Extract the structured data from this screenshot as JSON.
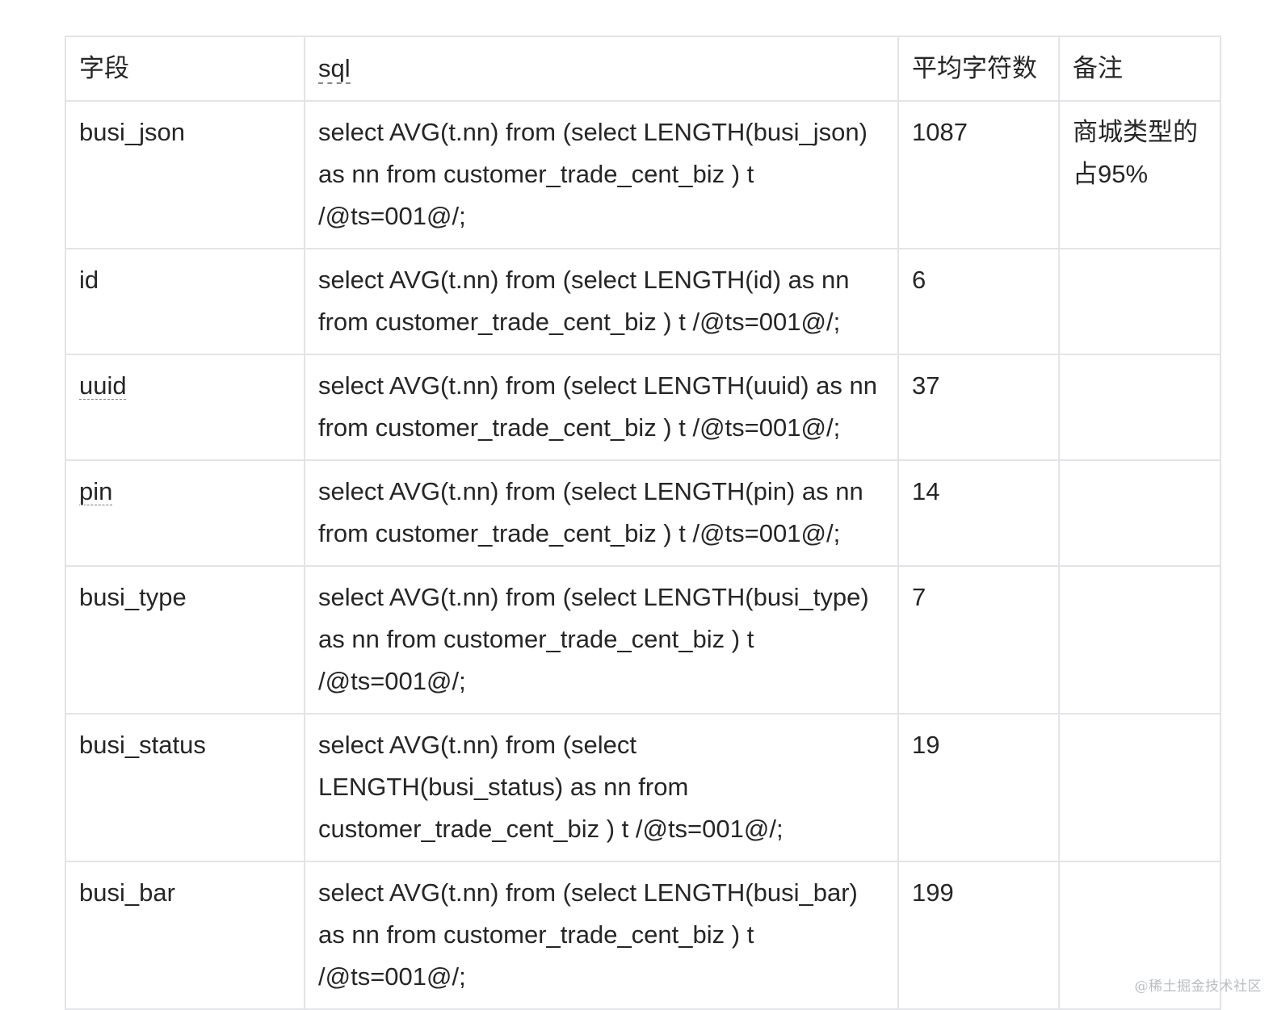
{
  "table": {
    "headers": {
      "field": "字段",
      "sql": "sql",
      "avg_chars": "平均字符数",
      "note": "备注"
    },
    "rows": [
      {
        "field": "busi_json",
        "sql": "select AVG(t.nn) from (select LENGTH(busi_json) as nn from customer_trade_cent_biz ) t /@ts=001@/;",
        "avg": "1087",
        "note": "商城类型的占95%"
      },
      {
        "field": "id",
        "sql": "select AVG(t.nn) from (select LENGTH(id) as nn from customer_trade_cent_biz ) t /@ts=001@/;",
        "avg": "6",
        "note": ""
      },
      {
        "field": "uuid",
        "sql": "select AVG(t.nn) from (select LENGTH(uuid) as nn from customer_trade_cent_biz ) t /@ts=001@/;",
        "avg": "37",
        "note": ""
      },
      {
        "field": "pin",
        "sql": "select AVG(t.nn) from (select LENGTH(pin) as nn from customer_trade_cent_biz ) t /@ts=001@/;",
        "avg": "14",
        "note": ""
      },
      {
        "field": "busi_type",
        "sql": "select AVG(t.nn) from (select LENGTH(busi_type) as nn from customer_trade_cent_biz ) t /@ts=001@/;",
        "avg": "7",
        "note": ""
      },
      {
        "field": "busi_status",
        "sql": "select AVG(t.nn) from (select LENGTH(busi_status) as nn from customer_trade_cent_biz ) t /@ts=001@/;",
        "avg": "19",
        "note": ""
      },
      {
        "field": "busi_bar",
        "sql": "select AVG(t.nn) from (select LENGTH(busi_bar) as nn from customer_trade_cent_biz ) t /@ts=001@/;",
        "avg": "199",
        "note": ""
      }
    ]
  },
  "footer": {
    "watermark_text": "@稀土掘金技术社区"
  },
  "colors": {
    "border": "#e2e4e7",
    "text": "#262626",
    "footer_text": "#b9bcc2"
  }
}
